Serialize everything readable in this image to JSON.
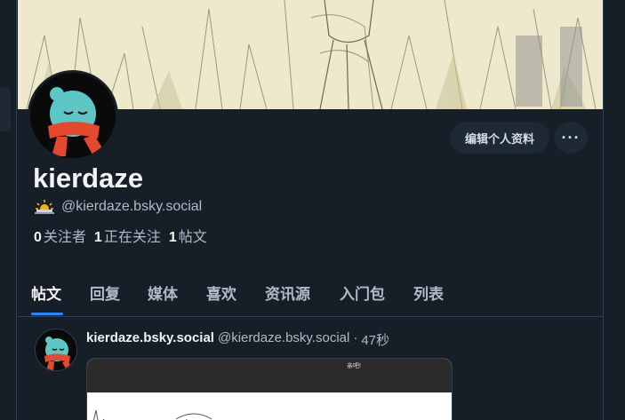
{
  "profile": {
    "display_name": "kierdaze",
    "handle": "@kierdaze.bsky.social",
    "emoji_icon": "sun-behind-cloud-icon",
    "followers_count": "0",
    "followers_label": "关注者",
    "following_count": "1",
    "following_label": "正在关注",
    "posts_count": "1",
    "posts_label": "帖文",
    "edit_button_label": "编辑个人资料",
    "more_button_label": "···"
  },
  "tabs": [
    {
      "label": "帖文",
      "active": true
    },
    {
      "label": "回复",
      "active": false
    },
    {
      "label": "媒体",
      "active": false
    },
    {
      "label": "喜欢",
      "active": false
    },
    {
      "label": "资讯源",
      "active": false
    },
    {
      "label": "入门包",
      "active": false
    },
    {
      "label": "列表",
      "active": false
    }
  ],
  "post": {
    "author_name": "kierdaze.bsky.social",
    "author_handle": "@kierdaze.bsky.social",
    "separator": "·",
    "time": "47秒",
    "image_caption": "亲吧!"
  },
  "colors": {
    "background": "#161e27",
    "button_bg": "#1e2936",
    "accent": "#208bfe",
    "text_primary": "#f1f3f5",
    "text_secondary": "#aebbc9",
    "avatar_scarf": "#e5482f",
    "avatar_face": "#5ec7c5"
  }
}
